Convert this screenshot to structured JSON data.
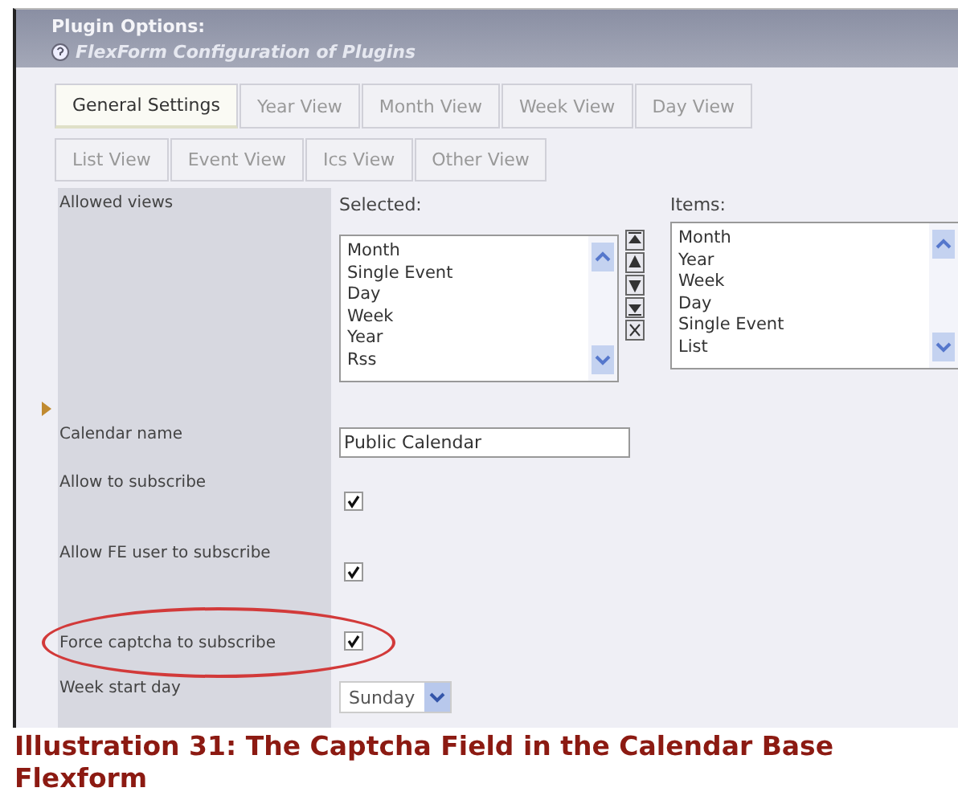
{
  "header": {
    "title": "Plugin Options:",
    "subtitle": "FlexForm Configuration of Plugins"
  },
  "tabs": [
    [
      {
        "label": "General Settings",
        "selected": true
      },
      {
        "label": "Year View",
        "selected": false
      },
      {
        "label": "Month View",
        "selected": false
      },
      {
        "label": "Week View",
        "selected": false
      },
      {
        "label": "Day View",
        "selected": false
      }
    ],
    [
      {
        "label": "List View",
        "selected": false
      },
      {
        "label": "Event View",
        "selected": false
      },
      {
        "label": "Ics View",
        "selected": false
      },
      {
        "label": "Other View",
        "selected": false
      }
    ]
  ],
  "allowed_views": {
    "label": "Allowed views",
    "selected_label": "Selected:",
    "selected_items": [
      "Month",
      "Single Event",
      "Day",
      "Week",
      "Year",
      "Rss"
    ],
    "items_label": "Items:",
    "items": [
      "Month",
      "Year",
      "Week",
      "Day",
      "Single Event",
      "List"
    ]
  },
  "fields": [
    {
      "kind": "text",
      "label": "Calendar name",
      "value": "Public Calendar"
    },
    {
      "kind": "checkbox",
      "label": "Allow to subscribe",
      "checked": true
    },
    {
      "kind": "checkbox",
      "label": "Allow FE user to subscribe",
      "checked": true
    },
    {
      "kind": "checkbox",
      "label": "Force captcha to subscribe",
      "checked": true,
      "highlighted": true
    },
    {
      "kind": "select",
      "label": "Week start day",
      "value": "Sunday"
    }
  ],
  "caption": "Illustration 31: The Captcha Field in the Calendar Base Flexform"
}
